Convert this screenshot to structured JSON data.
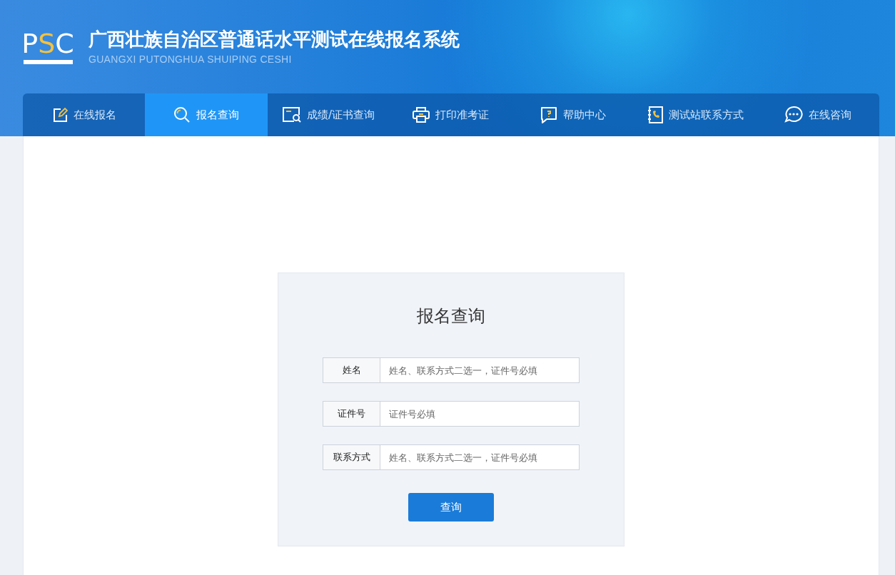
{
  "header": {
    "logo": "PSC",
    "title": "广西壮族自治区普通话水平测试在线报名系统",
    "subtitle": "GUANGXI PUTONGHUA SHUIPING CESHI"
  },
  "nav": [
    {
      "label": "在线报名",
      "selected": false
    },
    {
      "label": "报名查询",
      "selected": true
    },
    {
      "label": "成绩/证书查询",
      "selected": false
    },
    {
      "label": "打印准考证",
      "selected": false
    },
    {
      "label": "帮助中心",
      "selected": false
    },
    {
      "label": "测试站联系方式",
      "selected": false
    },
    {
      "label": "在线咨询",
      "selected": false
    }
  ],
  "form": {
    "title": "报名查询",
    "fields": [
      {
        "label": "姓名",
        "placeholder": "姓名、联系方式二选一，证件号必填"
      },
      {
        "label": "证件号",
        "placeholder": "证件号必填"
      },
      {
        "label": "联系方式",
        "placeholder": "姓名、联系方式二选一，证件号必填"
      }
    ],
    "submit": "查询"
  }
}
